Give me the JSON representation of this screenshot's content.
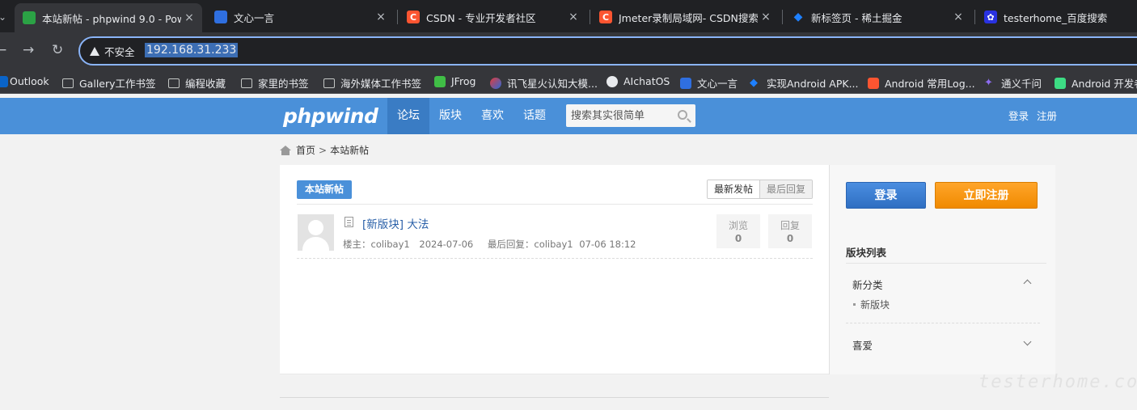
{
  "browser": {
    "tabs": [
      {
        "title": "本站新帖 - phpwind 9.0 - Pow",
        "icon": "phpwind-favicon",
        "active": true
      },
      {
        "title": "文心一言",
        "icon": "wenxin-icon"
      },
      {
        "title": "CSDN - 专业开发者社区",
        "icon": "csdn-icon"
      },
      {
        "title": "Jmeter录制局域网- CSDN搜索",
        "icon": "csdn-icon"
      },
      {
        "title": "新标签页 - 稀土掘金",
        "icon": "juejin-icon"
      },
      {
        "title": "testerhome_百度搜索",
        "icon": "baidu-icon"
      }
    ],
    "close_glyph": "×",
    "nav": {
      "back": "←",
      "forward": "→",
      "reload": "↻"
    },
    "security_label": "不安全",
    "url": "192.168.31.233",
    "bookmarks": [
      {
        "label": "Outlook",
        "icon": "outlook-icon"
      },
      {
        "label": "Gallery工作书签",
        "icon": "folder-icon"
      },
      {
        "label": "编程收藏",
        "icon": "folder-icon"
      },
      {
        "label": "家里的书签",
        "icon": "folder-icon"
      },
      {
        "label": "海外媒体工作书签",
        "icon": "folder-icon"
      },
      {
        "label": "JFrog",
        "icon": "jfrog-icon"
      },
      {
        "label": "讯飞星火认知大模...",
        "icon": "xunfei-icon"
      },
      {
        "label": "AIchatOS",
        "icon": "aichatos-icon"
      },
      {
        "label": "文心一言",
        "icon": "wenxin-icon"
      },
      {
        "label": "实现Android APK...",
        "icon": "juejin-icon"
      },
      {
        "label": "Android 常用Log...",
        "icon": "csdn-icon"
      },
      {
        "label": "通义千问",
        "icon": "tongyi-icon"
      },
      {
        "label": "Android 开发者",
        "icon": "android-icon"
      }
    ]
  },
  "site": {
    "logo": "phpwind",
    "nav": [
      "论坛",
      "版块",
      "喜欢",
      "话题"
    ],
    "search_placeholder": "搜索其实很简单",
    "login": "登录",
    "register": "注册"
  },
  "breadcrumb": {
    "home": "首页",
    "sep": ">",
    "current": "本站新帖"
  },
  "main": {
    "badge": "本站新帖",
    "sort_tabs": [
      "最新发帖",
      "最后回复"
    ],
    "posts": [
      {
        "title": "[新版块] 大法",
        "author_label": "楼主：",
        "author": "colibay1",
        "date": "2024-07-06",
        "last_reply_label": "最后回复：",
        "last_reply_user": "colibay1",
        "last_reply_time": "07-06 18:12",
        "views_label": "浏览",
        "views": 0,
        "replies_label": "回复",
        "replies": 0
      }
    ]
  },
  "sidebar": {
    "login_button": "登录",
    "register_button": "立即注册",
    "heading": "版块列表",
    "categories": [
      {
        "name": "新分类",
        "expanded": true,
        "children": [
          "新版块"
        ]
      },
      {
        "name": "喜爱",
        "expanded": false
      }
    ]
  },
  "watermark": "testerhome.com",
  "colors": {
    "header": "#4a90d9",
    "nav_active": "#3a7cc4",
    "login_button": "#3a7ed1",
    "register_button": "#f7960e",
    "link": "#2a60a8"
  }
}
